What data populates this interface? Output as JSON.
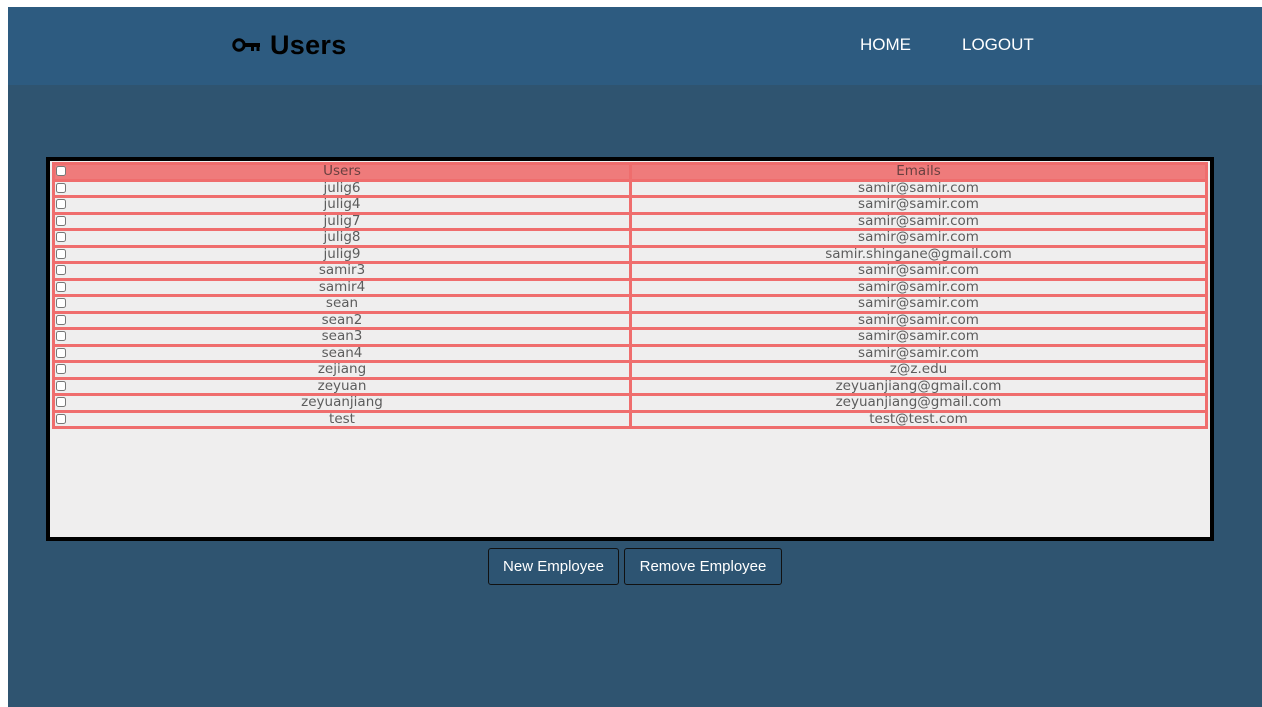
{
  "header": {
    "title": "Users",
    "icon": "key-icon",
    "nav": {
      "home": "HOME",
      "logout": "LOGOUT"
    }
  },
  "table": {
    "columns": {
      "users": "Users",
      "emails": "Emails"
    },
    "rows": [
      {
        "user": "julig6",
        "email": "samir@samir.com"
      },
      {
        "user": "julig4",
        "email": "samir@samir.com"
      },
      {
        "user": "julig7",
        "email": "samir@samir.com"
      },
      {
        "user": "julig8",
        "email": "samir@samir.com"
      },
      {
        "user": "julig9",
        "email": "samir.shingane@gmail.com"
      },
      {
        "user": "samir3",
        "email": "samir@samir.com"
      },
      {
        "user": "samir4",
        "email": "samir@samir.com"
      },
      {
        "user": "sean",
        "email": "samir@samir.com"
      },
      {
        "user": "sean2",
        "email": "samir@samir.com"
      },
      {
        "user": "sean3",
        "email": "samir@samir.com"
      },
      {
        "user": "sean4",
        "email": "samir@samir.com"
      },
      {
        "user": "zejiang",
        "email": "z@z.edu"
      },
      {
        "user": "zeyuan",
        "email": "zeyuanjiang@gmail.com"
      },
      {
        "user": "zeyuanjiang",
        "email": "zeyuanjiang@gmail.com"
      },
      {
        "user": "test",
        "email": "test@test.com"
      }
    ]
  },
  "actions": {
    "new_employee": "New Employee",
    "remove_employee": "Remove Employee"
  },
  "colors": {
    "page_background": "#2f5470",
    "header_background": "#2d5b80",
    "table_border": "#ef6d6d",
    "table_header_fill": "#ef7b7b",
    "button_background": "#2d5472"
  }
}
